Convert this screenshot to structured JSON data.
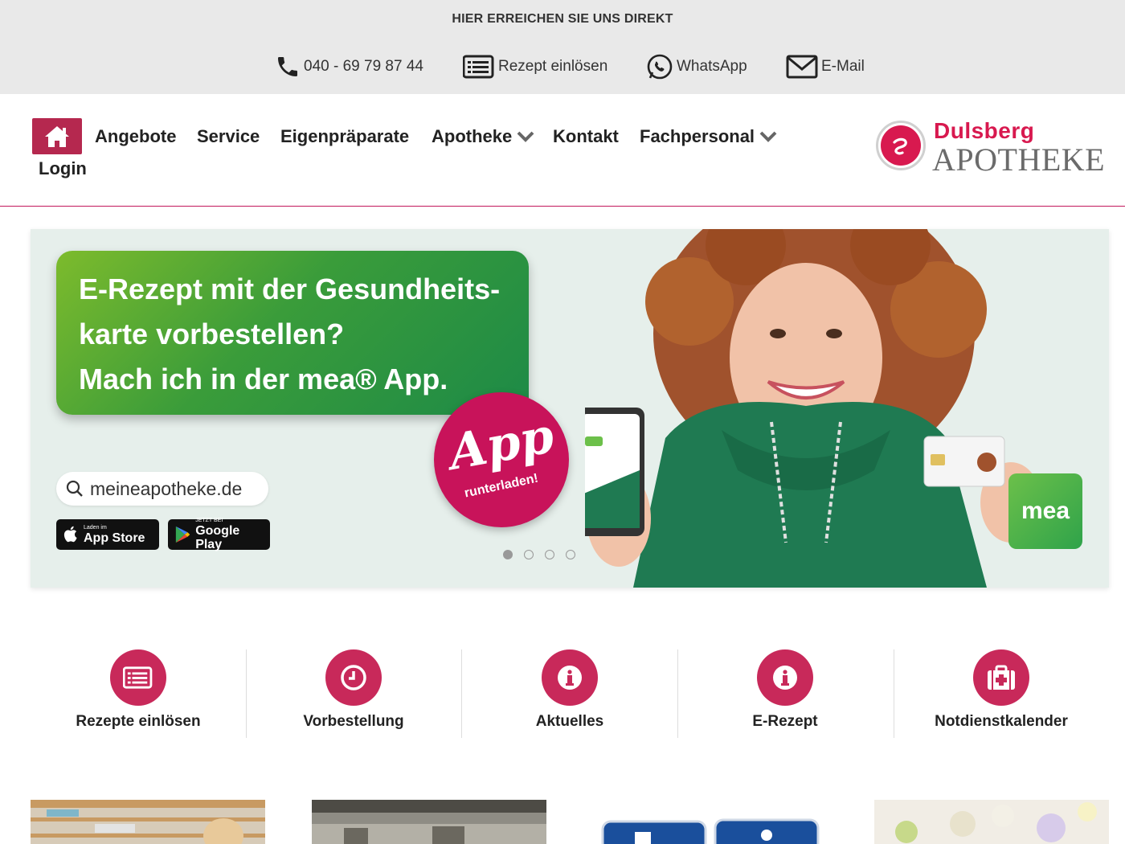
{
  "topbar": {
    "title": "HIER ERREICHEN SIE UNS DIREKT",
    "contacts": [
      {
        "label": "040 - 69 79 87 44",
        "icon": "phone-icon"
      },
      {
        "label": "Rezept einlösen",
        "icon": "prescription-icon"
      },
      {
        "label": "WhatsApp",
        "icon": "whatsapp-icon"
      },
      {
        "label": "E-Mail",
        "icon": "mail-icon"
      }
    ]
  },
  "nav": {
    "items": [
      {
        "label": "Angebote"
      },
      {
        "label": "Service"
      },
      {
        "label": "Eigenpräparate"
      },
      {
        "label": "Apotheke"
      },
      {
        "label": "Kontakt"
      },
      {
        "label": "Fachpersonal"
      }
    ],
    "login": "Login"
  },
  "logo": {
    "name": "Dulsberg",
    "sub": "APOTHEKE"
  },
  "hero": {
    "lines": [
      "E-Rezept mit der Gesundheits-",
      "karte vorbestellen?",
      "Mach ich in der mea® App."
    ],
    "badge_big": "App",
    "badge_small": "runterladen!",
    "search_text": "meineapotheke.de",
    "appstore_small": "Laden im",
    "appstore_big": "App Store",
    "googleplay_small": "JETZT BEI",
    "googleplay_big": "Google Play",
    "mea_label": "mea",
    "slides": 4,
    "active_slide": 1
  },
  "quicklinks": [
    {
      "label": "Rezepte einlösen",
      "icon": "prescription-icon"
    },
    {
      "label": "Vorbestellung",
      "icon": "clock-icon"
    },
    {
      "label": "Aktuelles",
      "icon": "info-icon"
    },
    {
      "label": "E-Rezept",
      "icon": "info-icon"
    },
    {
      "label": "Notdienstkalender",
      "icon": "first-aid-icon"
    }
  ],
  "colors": {
    "brand": "#c8295a",
    "topbar_bg": "#e9e9e9",
    "hero_green": "#3a9c3a"
  }
}
